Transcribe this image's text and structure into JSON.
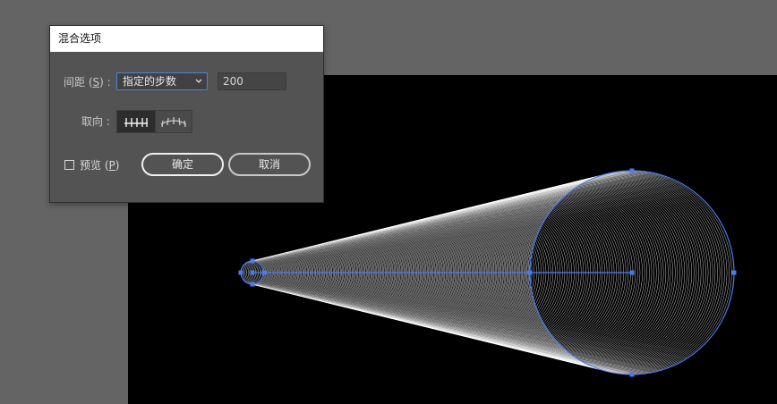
{
  "dialog": {
    "title": "混合选项",
    "spacing_label_prefix": "间距 (",
    "spacing_label_key": "S",
    "spacing_label_suffix": ") :",
    "spacing_mode": "指定的步数",
    "steps_value": "200",
    "orientation_label": "取向 :",
    "orientation_options": [
      "align-to-page-icon",
      "align-to-path-icon"
    ],
    "orientation_selected": "align-to-page-icon",
    "preview_label_prefix": "预览 (",
    "preview_label_key": "P",
    "preview_label_suffix": ")",
    "preview_checked": false,
    "ok_label": "确定",
    "cancel_label": "取消"
  },
  "colors": {
    "workspace": "#646464",
    "artboard": "#000000",
    "dialog_bg": "#535353",
    "selection": "#4a7bf0",
    "blend_lines": "#ffffff"
  }
}
